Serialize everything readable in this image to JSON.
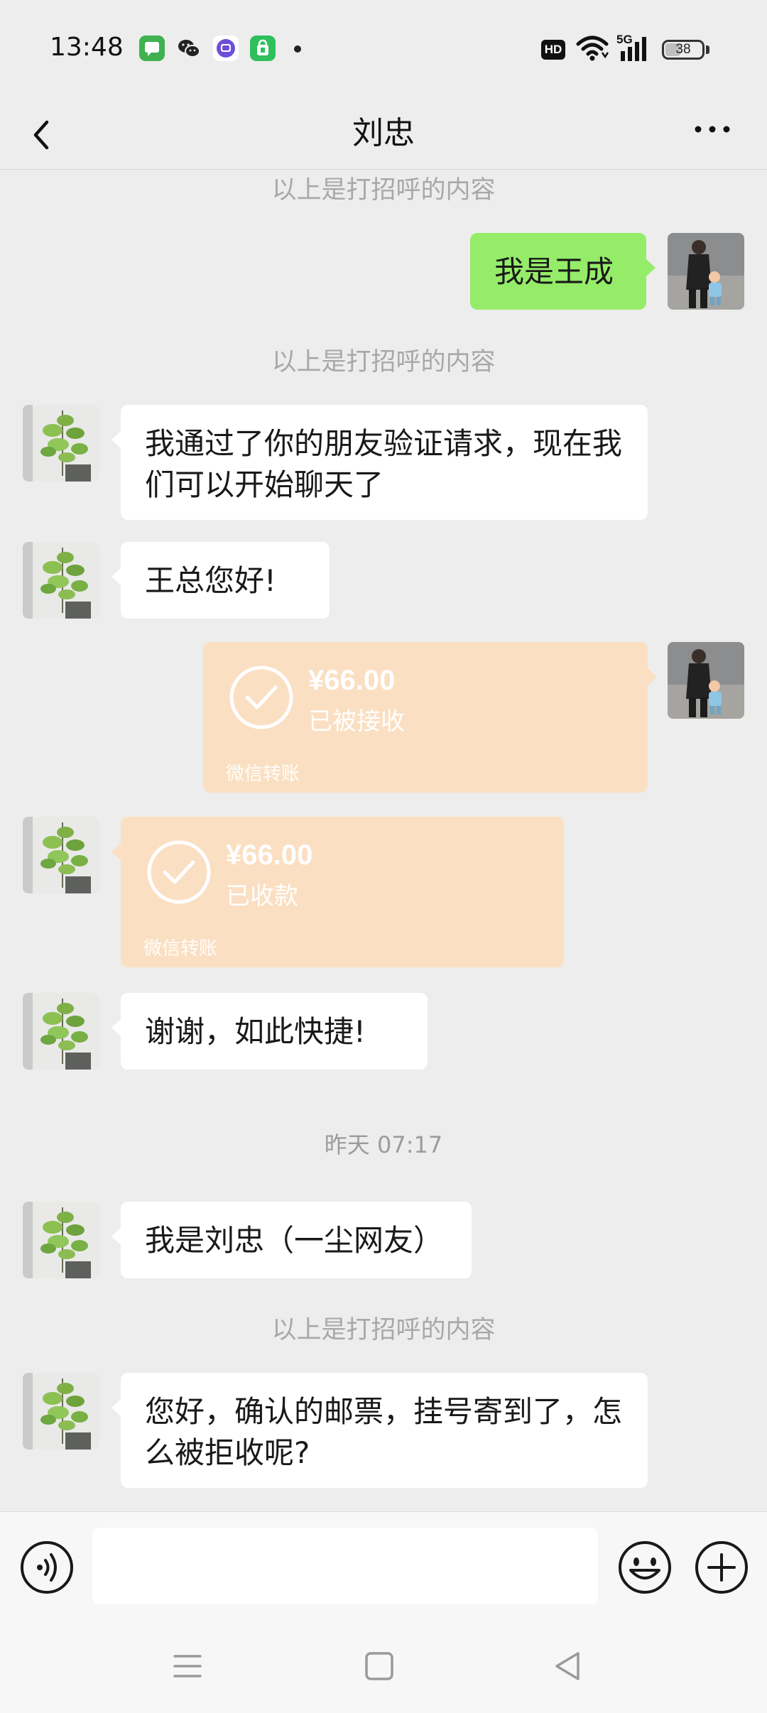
{
  "status_bar": {
    "time": "13:48",
    "apps": [
      {
        "name": "messages-app-icon",
        "color": "#3fb24f"
      },
      {
        "name": "wechat-app-icon",
        "color": "#222222"
      },
      {
        "name": "purple-app-icon",
        "color": "#6b4fd8"
      },
      {
        "name": "shopping-bag-app-icon",
        "color": "#2fbf5c"
      }
    ],
    "hd_label": "HD",
    "network_label": "5G",
    "battery_level": "38"
  },
  "header": {
    "title": "刘忠"
  },
  "messages": {
    "sys_1": "以上是打招呼的内容",
    "out_1": "我是王成",
    "sys_2": "以上是打招呼的内容",
    "in_1": "我通过了你的朋友验证请求，现在我们可以开始聊天了",
    "in_2": "王总您好!",
    "transfer_out": {
      "amount": "¥66.00",
      "status": "已被接收",
      "footer": "微信转账"
    },
    "transfer_in": {
      "amount": "¥66.00",
      "status": "已收款",
      "footer": "微信转账"
    },
    "in_3": "谢谢，如此快捷!",
    "time_sep": "昨天 07:17",
    "in_4": "我是刘忠（一尘网友）",
    "sys_3": "以上是打招呼的内容",
    "in_5": "您好，确认的邮票，挂号寄到了，怎么被拒收呢?"
  },
  "input_bar": {
    "text_value": ""
  },
  "colors": {
    "background": "#ededed",
    "outgoing_bubble": "#95ec69",
    "incoming_bubble": "#ffffff",
    "transfer_bubble": "#fbdfc2"
  }
}
